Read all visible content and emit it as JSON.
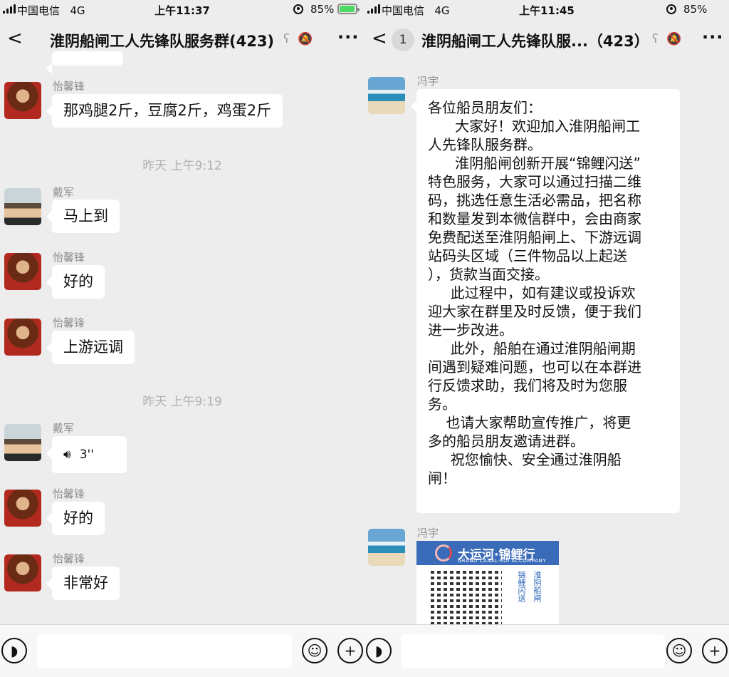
{
  "left": {
    "status": {
      "carrier": "中国电信",
      "network": "4G",
      "time": "上午11:37",
      "battery": "85%"
    },
    "header": {
      "title": "淮阴船闸工人先锋队服务群(423)",
      "more": "···"
    },
    "messages": {
      "m1": {
        "sender": "怡馨锋",
        "text": "那鸡腿2斤，豆腐2斤，鸡蛋2斤"
      },
      "t1": "昨天 上午9:12",
      "m2": {
        "sender": "戴军",
        "text": "马上到"
      },
      "m3": {
        "sender": "怡馨锋",
        "text": "好的"
      },
      "m4": {
        "sender": "怡馨锋",
        "text": "上游远调"
      },
      "t2": "昨天 上午9:19",
      "m5": {
        "sender": "戴军",
        "duration": "3''"
      },
      "m6": {
        "sender": "怡馨锋",
        "text": "好的"
      },
      "m7": {
        "sender": "怡馨锋",
        "text": "非常好"
      }
    }
  },
  "right": {
    "status": {
      "carrier": "中国电信",
      "network": "4G",
      "time": "上午11:45",
      "battery": "85%"
    },
    "header": {
      "badge": "1",
      "title": "淮阴船闸工人先锋队服...（423）",
      "more": "···"
    },
    "messages": {
      "m1": {
        "sender": "冯宇",
        "lines": [
          "各位船员朋友们：",
          "      大家好！欢迎加入淮阴船闸工",
          "人先锋队服务群。",
          "      淮阴船闸创新开展“锦鲤闪送”",
          "特色服务，大家可以通过扫描二维",
          "码，挑选任意生活必需品，把名称",
          "和数量发到本微信群中，会由商家",
          "免费配送至淮阴船闸上、下游远调",
          "站码头区域（三件物品以上起送",
          "），货款当面交接。",
          "     此过程中，如有建议或投诉欢",
          "迎大家在群里及时反馈，便于我们",
          "进一步改进。",
          "     此外，船舶在通过淮阴船闸期",
          "间遇到疑难问题，也可以在本群进",
          "行反馈求助，我们将及时为您服",
          "务。",
          "    也请大家帮助宣传推广，将更",
          "多的船员朋友邀请进群。",
          "     祝您愉快、安全通过淮阴船",
          "闸！"
        ]
      },
      "m2": {
        "sender": "冯宇",
        "card_title": "大运河·锦鲤行",
        "card_sub": "GRAND CANAL·KOI ACCOMPANY",
        "vtext1": "锦鲤闪送",
        "vtext2": "淮阴船闸"
      }
    }
  },
  "colors": {
    "background": "#ededed",
    "bubble": "#ffffff",
    "battery": "#4cd964",
    "card": "#3a6bb8"
  }
}
